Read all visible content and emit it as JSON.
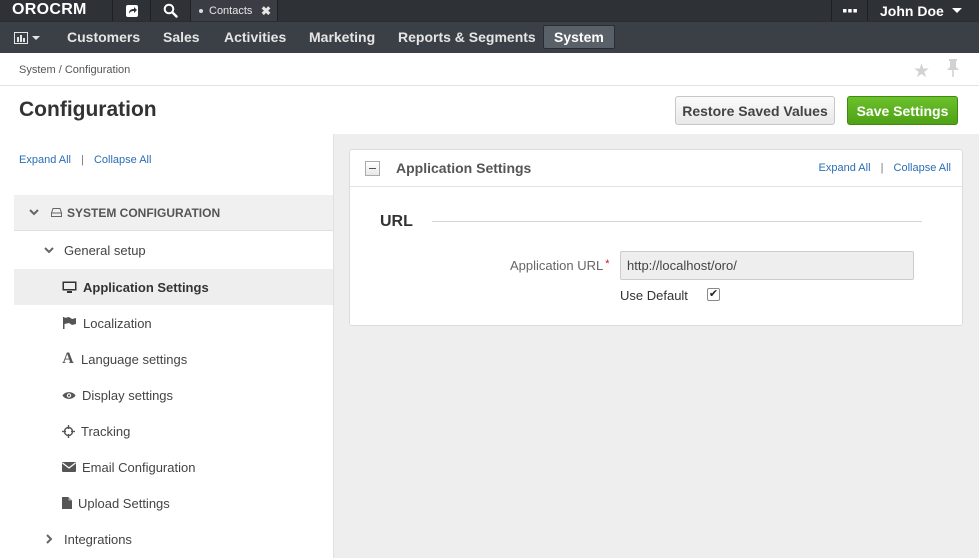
{
  "app": {
    "logo_text": "OROCRM"
  },
  "topbar": {
    "open_tab_label": "Contacts",
    "user_name": "John Doe"
  },
  "menu": {
    "items": [
      {
        "label": "Customers"
      },
      {
        "label": "Sales"
      },
      {
        "label": "Activities"
      },
      {
        "label": "Marketing"
      },
      {
        "label": "Reports & Segments"
      },
      {
        "label": "System"
      }
    ],
    "active_item": "System"
  },
  "breadcrumb": "System / Configuration",
  "page": {
    "title": "Configuration",
    "restore_label": "Restore Saved Values",
    "save_label": "Save Settings"
  },
  "sidebar": {
    "expand_all": "Expand All",
    "link_separator": "|",
    "collapse_all": "Collapse All",
    "tree": [
      {
        "label": "SYSTEM CONFIGURATION",
        "icon": "hdd-icon",
        "level": 0,
        "state": "expanded"
      },
      {
        "label": "General setup",
        "icon": "",
        "level": 1,
        "state": "expanded"
      },
      {
        "label": "Application Settings",
        "icon": "desktop-icon",
        "level": 2,
        "selected": true
      },
      {
        "label": "Localization",
        "icon": "flag-icon",
        "level": 2
      },
      {
        "label": "Language settings",
        "icon": "font-icon",
        "level": 2
      },
      {
        "label": "Display settings",
        "icon": "eye-icon",
        "level": 2
      },
      {
        "label": "Tracking",
        "icon": "crosshairs-icon",
        "level": 2
      },
      {
        "label": "Email Configuration",
        "icon": "envelope-icon",
        "level": 2
      },
      {
        "label": "Upload Settings",
        "icon": "file-icon",
        "level": 2
      },
      {
        "label": "Integrations",
        "icon": "",
        "level": 1,
        "state": "collapsed"
      }
    ]
  },
  "panel": {
    "title": "Application Settings",
    "expand_all": "Expand All",
    "link_separator": "|",
    "collapse_all": "Collapse All",
    "section_title": "URL",
    "field_label": "Application URL",
    "required_mark": "*",
    "field_value": "http://localhost/oro/",
    "use_default_label": "Use Default",
    "use_default_checked": true
  },
  "colors": {
    "topbar_bg": "#2e3136",
    "menubar_bg": "#3b4047",
    "save_button": "#5cb31f",
    "link": "#2a6eb5",
    "content_bg": "#eeeeee"
  }
}
